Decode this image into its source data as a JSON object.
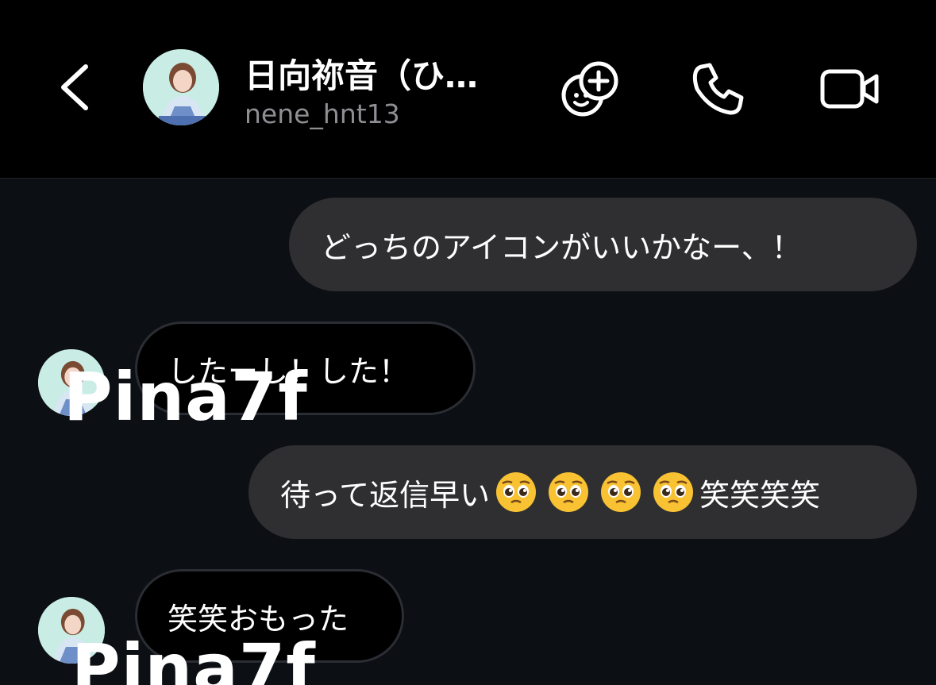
{
  "header": {
    "contact_name": "日向祢音（ひ…",
    "contact_handle": "nene_hnt13",
    "back_icon": "chevron-left-icon",
    "effects_icon": "sticker-add-icon",
    "call_icon": "phone-icon",
    "video_icon": "video-camera-icon"
  },
  "messages": [
    {
      "direction": "outgoing",
      "text": "どっちのアイコンがいいかなー、！"
    },
    {
      "direction": "incoming",
      "text": "したーし！した！"
    },
    {
      "direction": "outgoing",
      "text_before": "待って返信早い",
      "emoji": "pleading-face",
      "emoji_count": 4,
      "text_after": "笑笑笑笑"
    },
    {
      "direction": "incoming",
      "text": "笑笑おもった"
    }
  ],
  "watermark": "Pina7f",
  "colors": {
    "header_bg": "#000000",
    "chat_bg": "#0c0f14",
    "outgoing_bubble": "#2f2f31",
    "incoming_bubble": "#000000",
    "handle_text": "#8e8e93"
  }
}
